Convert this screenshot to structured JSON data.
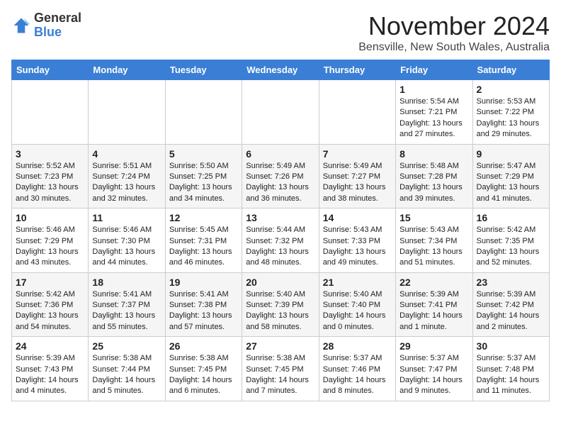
{
  "header": {
    "logo_general": "General",
    "logo_blue": "Blue",
    "month_title": "November 2024",
    "location": "Bensville, New South Wales, Australia"
  },
  "calendar": {
    "days_of_week": [
      "Sunday",
      "Monday",
      "Tuesday",
      "Wednesday",
      "Thursday",
      "Friday",
      "Saturday"
    ],
    "weeks": [
      [
        {
          "day": "",
          "content": ""
        },
        {
          "day": "",
          "content": ""
        },
        {
          "day": "",
          "content": ""
        },
        {
          "day": "",
          "content": ""
        },
        {
          "day": "",
          "content": ""
        },
        {
          "day": "1",
          "content": "Sunrise: 5:54 AM\nSunset: 7:21 PM\nDaylight: 13 hours\nand 27 minutes."
        },
        {
          "day": "2",
          "content": "Sunrise: 5:53 AM\nSunset: 7:22 PM\nDaylight: 13 hours\nand 29 minutes."
        }
      ],
      [
        {
          "day": "3",
          "content": "Sunrise: 5:52 AM\nSunset: 7:23 PM\nDaylight: 13 hours\nand 30 minutes."
        },
        {
          "day": "4",
          "content": "Sunrise: 5:51 AM\nSunset: 7:24 PM\nDaylight: 13 hours\nand 32 minutes."
        },
        {
          "day": "5",
          "content": "Sunrise: 5:50 AM\nSunset: 7:25 PM\nDaylight: 13 hours\nand 34 minutes."
        },
        {
          "day": "6",
          "content": "Sunrise: 5:49 AM\nSunset: 7:26 PM\nDaylight: 13 hours\nand 36 minutes."
        },
        {
          "day": "7",
          "content": "Sunrise: 5:49 AM\nSunset: 7:27 PM\nDaylight: 13 hours\nand 38 minutes."
        },
        {
          "day": "8",
          "content": "Sunrise: 5:48 AM\nSunset: 7:28 PM\nDaylight: 13 hours\nand 39 minutes."
        },
        {
          "day": "9",
          "content": "Sunrise: 5:47 AM\nSunset: 7:29 PM\nDaylight: 13 hours\nand 41 minutes."
        }
      ],
      [
        {
          "day": "10",
          "content": "Sunrise: 5:46 AM\nSunset: 7:29 PM\nDaylight: 13 hours\nand 43 minutes."
        },
        {
          "day": "11",
          "content": "Sunrise: 5:46 AM\nSunset: 7:30 PM\nDaylight: 13 hours\nand 44 minutes."
        },
        {
          "day": "12",
          "content": "Sunrise: 5:45 AM\nSunset: 7:31 PM\nDaylight: 13 hours\nand 46 minutes."
        },
        {
          "day": "13",
          "content": "Sunrise: 5:44 AM\nSunset: 7:32 PM\nDaylight: 13 hours\nand 48 minutes."
        },
        {
          "day": "14",
          "content": "Sunrise: 5:43 AM\nSunset: 7:33 PM\nDaylight: 13 hours\nand 49 minutes."
        },
        {
          "day": "15",
          "content": "Sunrise: 5:43 AM\nSunset: 7:34 PM\nDaylight: 13 hours\nand 51 minutes."
        },
        {
          "day": "16",
          "content": "Sunrise: 5:42 AM\nSunset: 7:35 PM\nDaylight: 13 hours\nand 52 minutes."
        }
      ],
      [
        {
          "day": "17",
          "content": "Sunrise: 5:42 AM\nSunset: 7:36 PM\nDaylight: 13 hours\nand 54 minutes."
        },
        {
          "day": "18",
          "content": "Sunrise: 5:41 AM\nSunset: 7:37 PM\nDaylight: 13 hours\nand 55 minutes."
        },
        {
          "day": "19",
          "content": "Sunrise: 5:41 AM\nSunset: 7:38 PM\nDaylight: 13 hours\nand 57 minutes."
        },
        {
          "day": "20",
          "content": "Sunrise: 5:40 AM\nSunset: 7:39 PM\nDaylight: 13 hours\nand 58 minutes."
        },
        {
          "day": "21",
          "content": "Sunrise: 5:40 AM\nSunset: 7:40 PM\nDaylight: 14 hours\nand 0 minutes."
        },
        {
          "day": "22",
          "content": "Sunrise: 5:39 AM\nSunset: 7:41 PM\nDaylight: 14 hours\nand 1 minute."
        },
        {
          "day": "23",
          "content": "Sunrise: 5:39 AM\nSunset: 7:42 PM\nDaylight: 14 hours\nand 2 minutes."
        }
      ],
      [
        {
          "day": "24",
          "content": "Sunrise: 5:39 AM\nSunset: 7:43 PM\nDaylight: 14 hours\nand 4 minutes."
        },
        {
          "day": "25",
          "content": "Sunrise: 5:38 AM\nSunset: 7:44 PM\nDaylight: 14 hours\nand 5 minutes."
        },
        {
          "day": "26",
          "content": "Sunrise: 5:38 AM\nSunset: 7:45 PM\nDaylight: 14 hours\nand 6 minutes."
        },
        {
          "day": "27",
          "content": "Sunrise: 5:38 AM\nSunset: 7:45 PM\nDaylight: 14 hours\nand 7 minutes."
        },
        {
          "day": "28",
          "content": "Sunrise: 5:37 AM\nSunset: 7:46 PM\nDaylight: 14 hours\nand 8 minutes."
        },
        {
          "day": "29",
          "content": "Sunrise: 5:37 AM\nSunset: 7:47 PM\nDaylight: 14 hours\nand 9 minutes."
        },
        {
          "day": "30",
          "content": "Sunrise: 5:37 AM\nSunset: 7:48 PM\nDaylight: 14 hours\nand 11 minutes."
        }
      ]
    ]
  }
}
